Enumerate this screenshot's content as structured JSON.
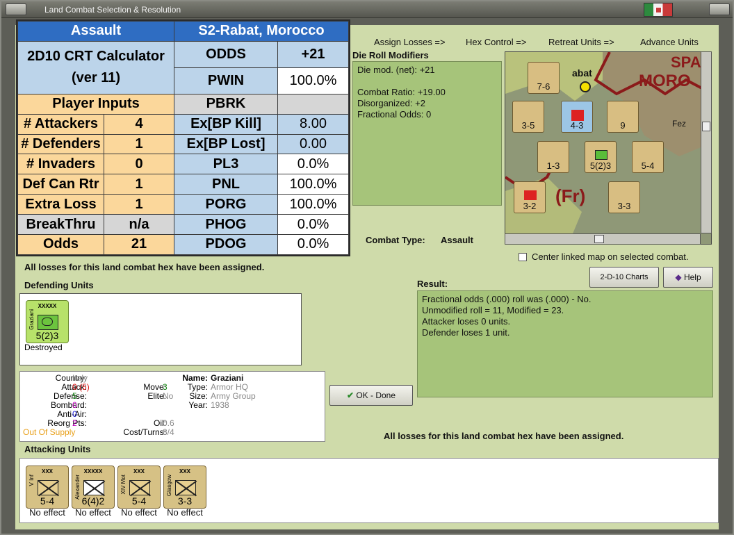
{
  "window": {
    "title": "Land Combat Selection & Resolution"
  },
  "nav": [
    "Assign Losses =>",
    "Hex Control =>",
    "Retreat Units =>",
    "Advance Units"
  ],
  "crt": {
    "header_left": "Assault",
    "header_right": "S2-Rabat, Morocco",
    "calc_title": "2D10 CRT Calculator",
    "calc_ver": "(ver 11)",
    "player_inputs": "Player Inputs",
    "inputs": [
      {
        "label": "# Attackers",
        "value": "4"
      },
      {
        "label": "# Defenders",
        "value": "1"
      },
      {
        "label": "# Invaders",
        "value": "0"
      },
      {
        "label": "Def Can Rtr",
        "value": "1"
      },
      {
        "label": "Extra Loss",
        "value": "1"
      },
      {
        "label": "BreakThru",
        "value": "n/a"
      },
      {
        "label": "Odds",
        "value": "21"
      }
    ],
    "outputs": [
      {
        "label": "ODDS",
        "value": "+21"
      },
      {
        "label": "PWIN",
        "value": "100.0%"
      },
      {
        "label": "PBRK",
        "value": ""
      },
      {
        "label": "Ex[BP Kill]",
        "value": "8.00"
      },
      {
        "label": "Ex[BP Lost]",
        "value": "0.00"
      },
      {
        "label": "PL3",
        "value": "0.0%"
      },
      {
        "label": "PNL",
        "value": "100.0%"
      },
      {
        "label": "PORG",
        "value": "100.0%"
      },
      {
        "label": "PHOG",
        "value": "0.0%"
      },
      {
        "label": "PDOG",
        "value": "0.0%"
      }
    ]
  },
  "die_roll": {
    "title": "Die Roll Modifiers",
    "lines": [
      "Die mod. (net): +21",
      "",
      "Combat Ratio: +19.00",
      "Disorganized: +2",
      "Fractional Odds: 0"
    ]
  },
  "combat_type": {
    "label": "Combat Type:",
    "value": "Assault"
  },
  "center_map": "Center linked map on selected combat.",
  "losses_msg": "All losses for this land combat hex have been assigned.",
  "defending": {
    "title": "Defending Units",
    "unit": {
      "size": "XXXXX",
      "name": "Graziani",
      "stat": "5(2)3",
      "effect": "Destroyed"
    }
  },
  "result": {
    "title": "Result:",
    "lines": [
      "Fractional odds (.000) roll was (.000)  - No.",
      "Unmodified roll = 11, Modified = 23.",
      "Attacker loses 0 units.",
      "Defender loses 1 unit."
    ]
  },
  "buttons": {
    "charts": "2-D-10 Charts",
    "help": "Help",
    "ok": "OK - Done"
  },
  "unit_info": {
    "country_label": "Country:",
    "country": "Italy",
    "attack_label": "Attack:",
    "attack": "0",
    "attack_paren": "(5)",
    "defense_label": "Defense:",
    "defense": "5",
    "bombard_label": "Bombard:",
    "bombard": "0",
    "antiair_label": "Anti-Air:",
    "antiair": "0",
    "reorg_label": "Reorg Pts:",
    "reorg": "2",
    "supply": "Out Of Supply",
    "move_label": "Move:",
    "move": "3",
    "elite_label": "Elite:",
    "elite": "No",
    "oil_label": "Oil:",
    "oil": "0.6",
    "cost_label": "Cost/Turns:",
    "cost": "8/4",
    "name_label": "Name:",
    "name": "Graziani",
    "type_label": "Type:",
    "type": "Armor HQ",
    "size_label": "Size:",
    "size": "Army Group",
    "year_label": "Year:",
    "year": "1938"
  },
  "attacking": {
    "title": "Attacking Units",
    "units": [
      {
        "size": "XXX",
        "name": "V Inf",
        "stat": "5-4",
        "effect": "No effect"
      },
      {
        "size": "XXXXX",
        "name": "Alexander",
        "stat": "6(4)2",
        "effect": "No effect"
      },
      {
        "size": "XXX",
        "name": "XIV Mot",
        "stat": "5-4",
        "effect": "No effect"
      },
      {
        "size": "XXX",
        "name": "Glasgow",
        "stat": "3-3",
        "effect": "No effect"
      }
    ]
  },
  "map": {
    "labels": [
      "SPA",
      "MORO",
      "abat",
      "Fez",
      "(Fr)"
    ],
    "counters": [
      "7-6",
      "3-5",
      "4-3",
      "9",
      "1-3",
      "5(2)3",
      "5-4",
      "3-2",
      "3-3"
    ]
  },
  "colors": {
    "panel": "#a6c47a",
    "background": "#cfdbaa",
    "crt_header": "#2f6dc2",
    "crt_peach": "#fbd79b",
    "crt_blue": "#bcd4ea"
  }
}
